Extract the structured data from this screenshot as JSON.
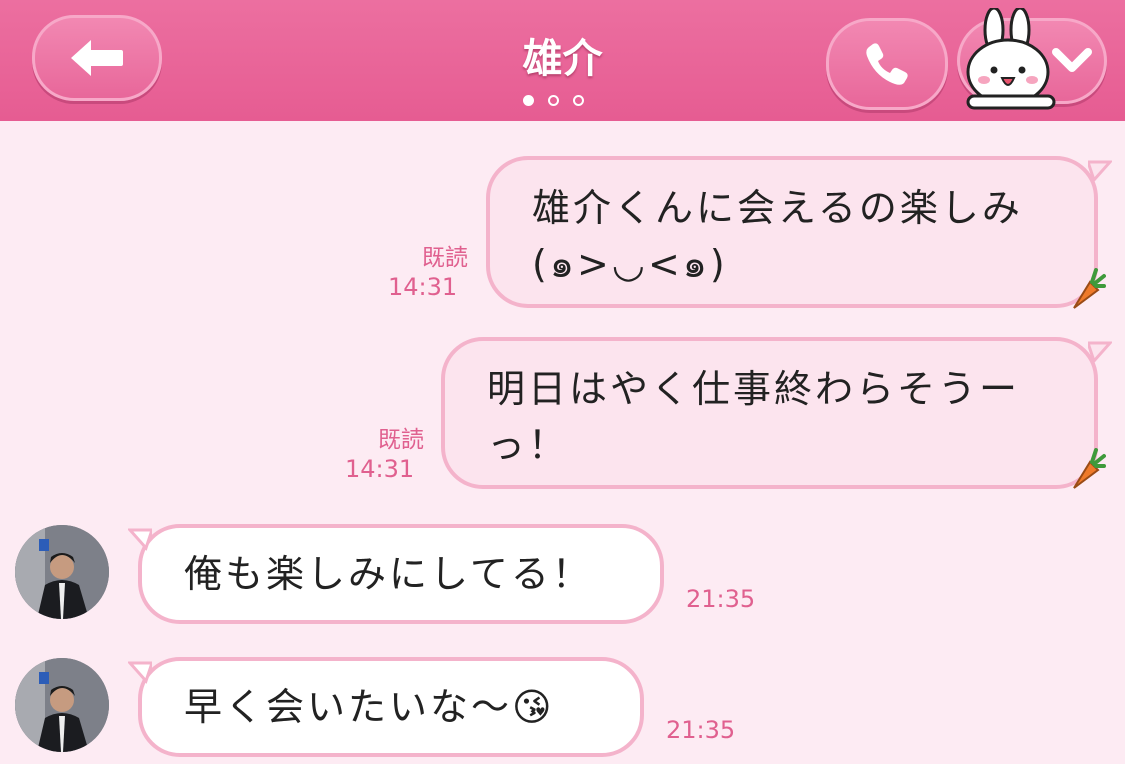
{
  "header": {
    "title": "雄介",
    "page_dots": 3,
    "active_dot": 0,
    "accent": "#e65c92"
  },
  "messages": [
    {
      "direction": "out",
      "text": "雄介くんに会えるの楽しみ\n(๑>◡<๑)",
      "read": "既読",
      "time": "14:31"
    },
    {
      "direction": "out",
      "text": "明日はやく仕事終わらそうー\nっ！",
      "read": "既読",
      "time": "14:31"
    },
    {
      "direction": "in",
      "text": "俺も楽しみにしてる！",
      "time": "21:35"
    },
    {
      "direction": "in",
      "text": "早く会いたいな〜😘",
      "time": "21:35"
    }
  ],
  "icons": [
    "back-arrow-icon",
    "phone-icon",
    "bunny-sticker-icon",
    "chevron-down-icon",
    "carrot-icon",
    "avatar-icon"
  ]
}
